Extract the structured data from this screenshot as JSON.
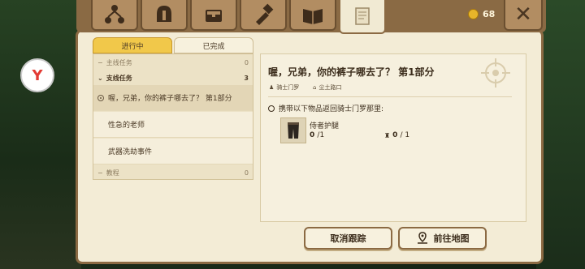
{
  "logo_text": "Y",
  "top_tabs": [
    {
      "icon": "skill-tree-icon"
    },
    {
      "icon": "helmet-icon"
    },
    {
      "icon": "chest-icon"
    },
    {
      "icon": "crafting-icon"
    },
    {
      "icon": "map-book-icon"
    },
    {
      "icon": "quest-scroll-icon"
    }
  ],
  "coins": {
    "icon": "coin-icon",
    "value": "68"
  },
  "close_icon": "close-icon",
  "status_tabs": {
    "in_progress": "进行中",
    "completed": "已完成"
  },
  "list": {
    "main_quests": {
      "label": "主线任务",
      "count": "0"
    },
    "side_quests": {
      "label": "支线任务",
      "count": "3"
    },
    "items": [
      "喔，兄弟，你的裤子哪去了？ 第1部分",
      "性急的老师",
      "武器洗劫事件"
    ],
    "tutorial": {
      "label": "教程",
      "count": "0"
    }
  },
  "detail": {
    "title": "喔，兄弟，你的裤子哪去了？ 第1部分",
    "npc": "骑士门罗",
    "location": "尘土路口",
    "objective": "携带以下物品返回骑士门罗那里:",
    "item": {
      "name": "侍者护腿",
      "have": "0",
      "need": "/1",
      "have2": "0",
      "need2": "/ 1"
    }
  },
  "buttons": {
    "untrack": "取消跟踪",
    "go_map": "前往地图"
  },
  "colors": {
    "accent": "#f1c84a",
    "frame": "#8b6a43",
    "parchment": "#f3ecd6"
  }
}
